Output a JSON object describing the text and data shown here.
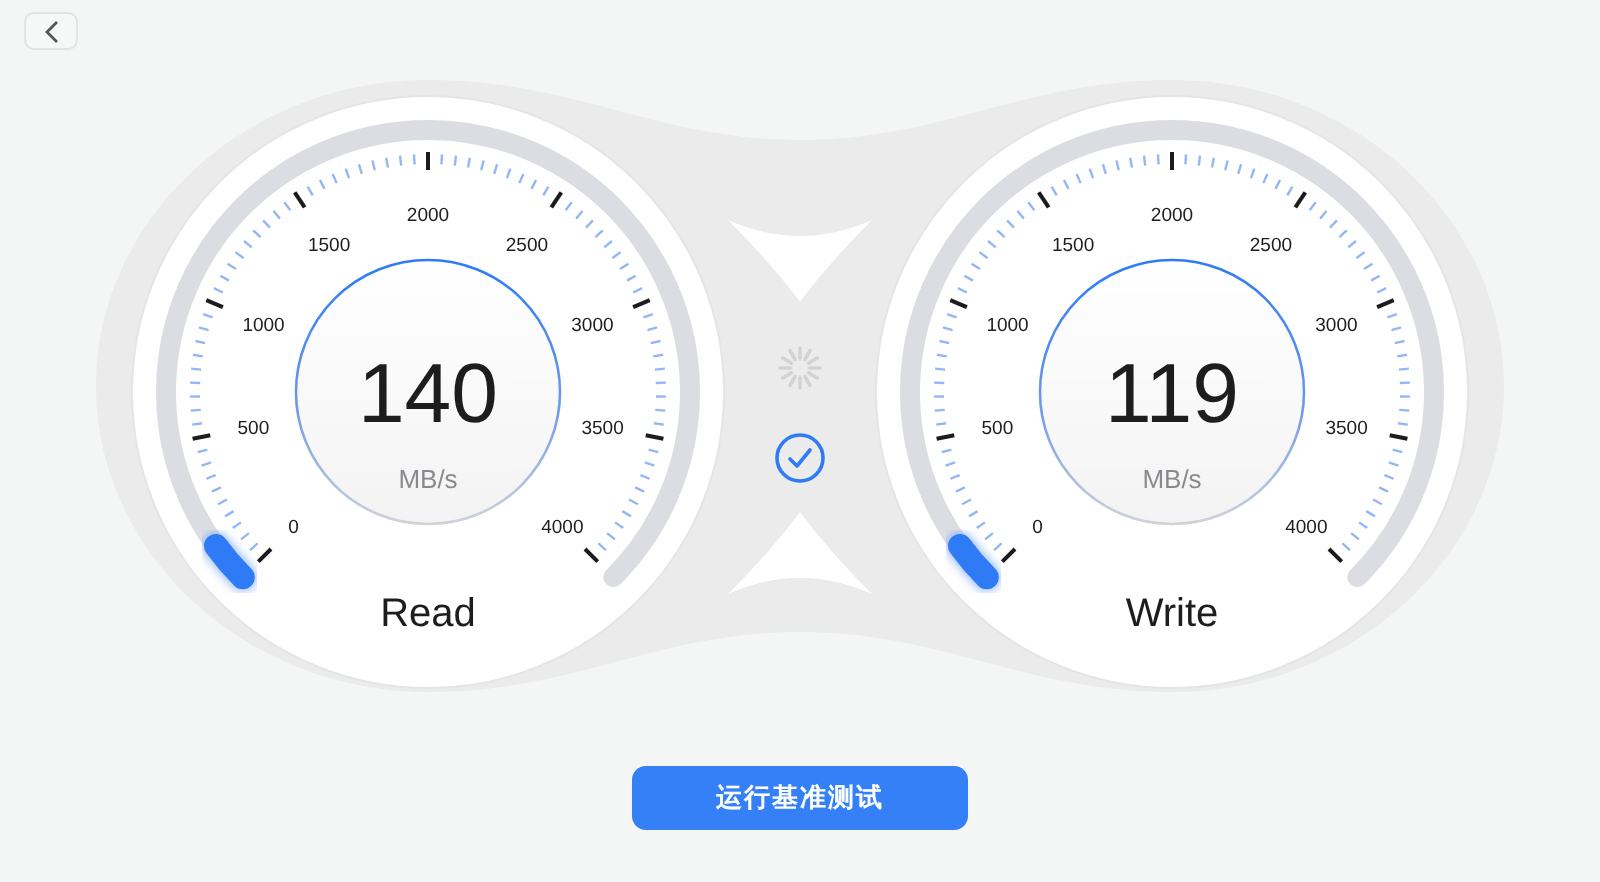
{
  "gauges": [
    {
      "label": "Read",
      "value": "140",
      "unit": "MB/s",
      "scale": [
        "0",
        "500",
        "1000",
        "1500",
        "2000",
        "2500",
        "3000",
        "3500",
        "4000"
      ]
    },
    {
      "label": "Write",
      "value": "119",
      "unit": "MB/s",
      "scale": [
        "0",
        "500",
        "1000",
        "1500",
        "2000",
        "2500",
        "3000",
        "3500",
        "4000"
      ]
    }
  ],
  "run_button": {
    "label": "运行基准测试"
  }
}
